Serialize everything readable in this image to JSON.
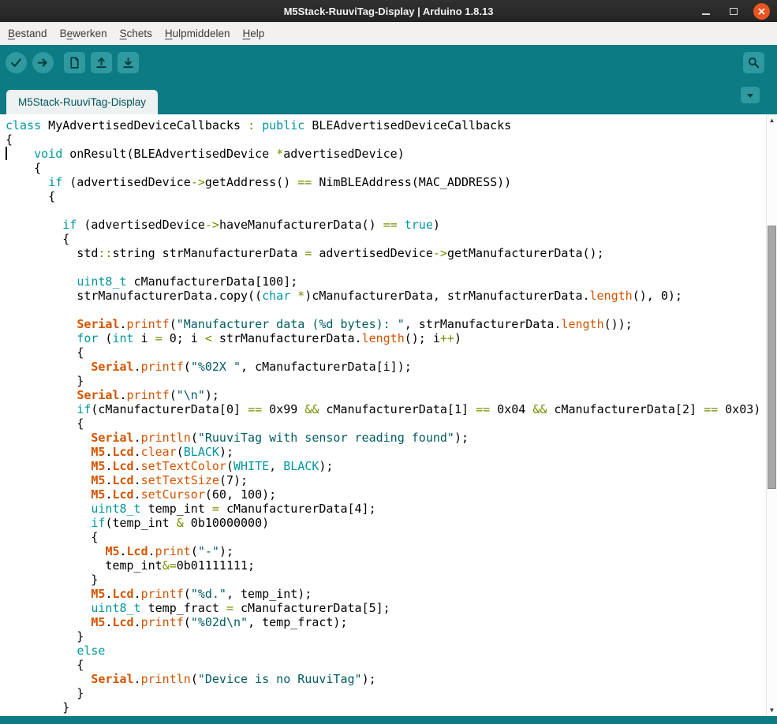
{
  "window": {
    "title": "M5Stack-RuuviTag-Display | Arduino 1.8.13"
  },
  "menubar": {
    "items": [
      {
        "pre": "",
        "key": "B",
        "post": "estand"
      },
      {
        "pre": "B",
        "key": "e",
        "post": "werken"
      },
      {
        "pre": "",
        "key": "S",
        "post": "chets"
      },
      {
        "pre": "",
        "key": "H",
        "post": "ulpmiddelen"
      },
      {
        "pre": "",
        "key": "H",
        "post": "elp"
      }
    ]
  },
  "toolbar": {
    "buttons": [
      "verify",
      "upload",
      "new",
      "open",
      "save"
    ],
    "right_button": "serial-monitor"
  },
  "tabs": {
    "active": "M5Stack-RuuviTag-Display"
  },
  "icons": {
    "verify": "check",
    "upload": "arrow-right",
    "new": "document",
    "open": "arrow-up-tray",
    "save": "arrow-down-tray",
    "serial_monitor": "magnifier",
    "tab_menu": "triangle-down",
    "scroll_up": "triangle-up",
    "scroll_down": "triangle-down",
    "minimize": "dash",
    "maximize": "square-outline",
    "close": "cross"
  },
  "colors": {
    "teal_chrome": "#0c7b84",
    "teal_button": "#2f99a0",
    "close_orange": "#E95420",
    "keyword": "#00979C",
    "function": "#D35400",
    "string": "#005C5F",
    "operator": "#728E00",
    "tab_bg": "#eef1f1"
  },
  "scroll": {
    "up_glyph": "▲",
    "down_glyph": "▼"
  },
  "editor": {
    "lines": [
      [
        [
          "k",
          "class"
        ],
        [
          "p",
          " MyAdvertisedDeviceCallbacks "
        ],
        [
          "o",
          ":"
        ],
        [
          "p",
          " "
        ],
        [
          "k",
          "public"
        ],
        [
          "p",
          " BLEAdvertisedDeviceCallbacks"
        ]
      ],
      [
        [
          "p",
          "{"
        ]
      ],
      [
        [
          "p",
          "    "
        ],
        [
          "k",
          "void"
        ],
        [
          "p",
          " onResult(BLEAdvertisedDevice "
        ],
        [
          "o",
          "*"
        ],
        [
          "p",
          "advertisedDevice)"
        ]
      ],
      [
        [
          "p",
          "    {"
        ]
      ],
      [
        [
          "p",
          "      "
        ],
        [
          "k",
          "if"
        ],
        [
          "p",
          " (advertisedDevice"
        ],
        [
          "o",
          "->"
        ],
        [
          "p",
          "getAddress() "
        ],
        [
          "o",
          "=="
        ],
        [
          "p",
          " NimBLEAddress(MAC_ADDRESS))"
        ]
      ],
      [
        [
          "p",
          "      {"
        ]
      ],
      [],
      [
        [
          "p",
          "        "
        ],
        [
          "k",
          "if"
        ],
        [
          "p",
          " (advertisedDevice"
        ],
        [
          "o",
          "->"
        ],
        [
          "p",
          "haveManufacturerData() "
        ],
        [
          "o",
          "=="
        ],
        [
          "p",
          " "
        ],
        [
          "k",
          "true"
        ],
        [
          "p",
          ")"
        ]
      ],
      [
        [
          "p",
          "        {"
        ]
      ],
      [
        [
          "p",
          "          std"
        ],
        [
          "o",
          "::"
        ],
        [
          "p",
          "string strManufacturerData "
        ],
        [
          "o",
          "="
        ],
        [
          "p",
          " advertisedDevice"
        ],
        [
          "o",
          "->"
        ],
        [
          "p",
          "getManufacturerData();"
        ]
      ],
      [],
      [
        [
          "p",
          "          "
        ],
        [
          "k",
          "uint8_t"
        ],
        [
          "p",
          " cManufacturerData[100];"
        ]
      ],
      [
        [
          "p",
          "          strManufacturerData.copy(("
        ],
        [
          "k",
          "char"
        ],
        [
          "p",
          " "
        ],
        [
          "o",
          "*"
        ],
        [
          "p",
          ")cManufacturerData, strManufacturerData."
        ],
        [
          "f",
          "length"
        ],
        [
          "p",
          "(), 0);"
        ]
      ],
      [],
      [
        [
          "p",
          "          "
        ],
        [
          "b",
          "Serial"
        ],
        [
          "p",
          "."
        ],
        [
          "f",
          "printf"
        ],
        [
          "p",
          "("
        ],
        [
          "s",
          "\"Manufacturer data (%d bytes): \""
        ],
        [
          "p",
          ", strManufacturerData."
        ],
        [
          "f",
          "length"
        ],
        [
          "p",
          "());"
        ]
      ],
      [
        [
          "p",
          "          "
        ],
        [
          "k",
          "for"
        ],
        [
          "p",
          " ("
        ],
        [
          "k",
          "int"
        ],
        [
          "p",
          " i "
        ],
        [
          "o",
          "="
        ],
        [
          "p",
          " 0; i "
        ],
        [
          "o",
          "<"
        ],
        [
          "p",
          " strManufacturerData."
        ],
        [
          "f",
          "length"
        ],
        [
          "p",
          "(); i"
        ],
        [
          "o",
          "++"
        ],
        [
          "p",
          ")"
        ]
      ],
      [
        [
          "p",
          "          {"
        ]
      ],
      [
        [
          "p",
          "            "
        ],
        [
          "b",
          "Serial"
        ],
        [
          "p",
          "."
        ],
        [
          "f",
          "printf"
        ],
        [
          "p",
          "("
        ],
        [
          "s",
          "\"%02X \""
        ],
        [
          "p",
          ", cManufacturerData[i]);"
        ]
      ],
      [
        [
          "p",
          "          }"
        ]
      ],
      [
        [
          "p",
          "          "
        ],
        [
          "b",
          "Serial"
        ],
        [
          "p",
          "."
        ],
        [
          "f",
          "printf"
        ],
        [
          "p",
          "("
        ],
        [
          "s",
          "\"\\n\""
        ],
        [
          "p",
          ");"
        ]
      ],
      [
        [
          "p",
          "          "
        ],
        [
          "k",
          "if"
        ],
        [
          "p",
          "(cManufacturerData[0] "
        ],
        [
          "o",
          "=="
        ],
        [
          "p",
          " 0x99 "
        ],
        [
          "o",
          "&&"
        ],
        [
          "p",
          " cManufacturerData[1] "
        ],
        [
          "o",
          "=="
        ],
        [
          "p",
          " 0x04 "
        ],
        [
          "o",
          "&&"
        ],
        [
          "p",
          " cManufacturerData[2] "
        ],
        [
          "o",
          "=="
        ],
        [
          "p",
          " 0x03)"
        ]
      ],
      [
        [
          "p",
          "          {"
        ]
      ],
      [
        [
          "p",
          "            "
        ],
        [
          "b",
          "Serial"
        ],
        [
          "p",
          "."
        ],
        [
          "f",
          "println"
        ],
        [
          "p",
          "("
        ],
        [
          "s",
          "\"RuuviTag with sensor reading found\""
        ],
        [
          "p",
          ");"
        ]
      ],
      [
        [
          "p",
          "            "
        ],
        [
          "b",
          "M5"
        ],
        [
          "p",
          "."
        ],
        [
          "b",
          "Lcd"
        ],
        [
          "p",
          "."
        ],
        [
          "f",
          "clear"
        ],
        [
          "p",
          "("
        ],
        [
          "k",
          "BLACK"
        ],
        [
          "p",
          ");"
        ]
      ],
      [
        [
          "p",
          "            "
        ],
        [
          "b",
          "M5"
        ],
        [
          "p",
          "."
        ],
        [
          "b",
          "Lcd"
        ],
        [
          "p",
          "."
        ],
        [
          "f",
          "setTextColor"
        ],
        [
          "p",
          "("
        ],
        [
          "k",
          "WHITE"
        ],
        [
          "p",
          ", "
        ],
        [
          "k",
          "BLACK"
        ],
        [
          "p",
          ");"
        ]
      ],
      [
        [
          "p",
          "            "
        ],
        [
          "b",
          "M5"
        ],
        [
          "p",
          "."
        ],
        [
          "b",
          "Lcd"
        ],
        [
          "p",
          "."
        ],
        [
          "f",
          "setTextSize"
        ],
        [
          "p",
          "(7);"
        ]
      ],
      [
        [
          "p",
          "            "
        ],
        [
          "b",
          "M5"
        ],
        [
          "p",
          "."
        ],
        [
          "b",
          "Lcd"
        ],
        [
          "p",
          "."
        ],
        [
          "f",
          "setCursor"
        ],
        [
          "p",
          "(60, 100);"
        ]
      ],
      [
        [
          "p",
          "            "
        ],
        [
          "k",
          "uint8_t"
        ],
        [
          "p",
          " temp_int "
        ],
        [
          "o",
          "="
        ],
        [
          "p",
          " cManufacturerData[4];"
        ]
      ],
      [
        [
          "p",
          "            "
        ],
        [
          "k",
          "if"
        ],
        [
          "p",
          "(temp_int "
        ],
        [
          "o",
          "&"
        ],
        [
          "p",
          " 0b10000000)"
        ]
      ],
      [
        [
          "p",
          "            {"
        ]
      ],
      [
        [
          "p",
          "              "
        ],
        [
          "b",
          "M5"
        ],
        [
          "p",
          "."
        ],
        [
          "b",
          "Lcd"
        ],
        [
          "p",
          "."
        ],
        [
          "f",
          "print"
        ],
        [
          "p",
          "("
        ],
        [
          "s",
          "\"-\""
        ],
        [
          "p",
          ");"
        ]
      ],
      [
        [
          "p",
          "              temp_int"
        ],
        [
          "o",
          "&="
        ],
        [
          "p",
          "0b01111111;"
        ]
      ],
      [
        [
          "p",
          "            }"
        ]
      ],
      [
        [
          "p",
          "            "
        ],
        [
          "b",
          "M5"
        ],
        [
          "p",
          "."
        ],
        [
          "b",
          "Lcd"
        ],
        [
          "p",
          "."
        ],
        [
          "f",
          "printf"
        ],
        [
          "p",
          "("
        ],
        [
          "s",
          "\"%d.\""
        ],
        [
          "p",
          ", temp_int);"
        ]
      ],
      [
        [
          "p",
          "            "
        ],
        [
          "k",
          "uint8_t"
        ],
        [
          "p",
          " temp_fract "
        ],
        [
          "o",
          "="
        ],
        [
          "p",
          " cManufacturerData[5];"
        ]
      ],
      [
        [
          "p",
          "            "
        ],
        [
          "b",
          "M5"
        ],
        [
          "p",
          "."
        ],
        [
          "b",
          "Lcd"
        ],
        [
          "p",
          "."
        ],
        [
          "f",
          "printf"
        ],
        [
          "p",
          "("
        ],
        [
          "s",
          "\"%02d\\n\""
        ],
        [
          "p",
          ", temp_fract);"
        ]
      ],
      [
        [
          "p",
          "          }"
        ]
      ],
      [
        [
          "p",
          "          "
        ],
        [
          "k",
          "else"
        ]
      ],
      [
        [
          "p",
          "          {"
        ]
      ],
      [
        [
          "p",
          "            "
        ],
        [
          "b",
          "Serial"
        ],
        [
          "p",
          "."
        ],
        [
          "f",
          "println"
        ],
        [
          "p",
          "("
        ],
        [
          "s",
          "\"Device is no RuuviTag\""
        ],
        [
          "p",
          ");"
        ]
      ],
      [
        [
          "p",
          "          }"
        ]
      ],
      [
        [
          "p",
          "        }"
        ]
      ]
    ]
  }
}
